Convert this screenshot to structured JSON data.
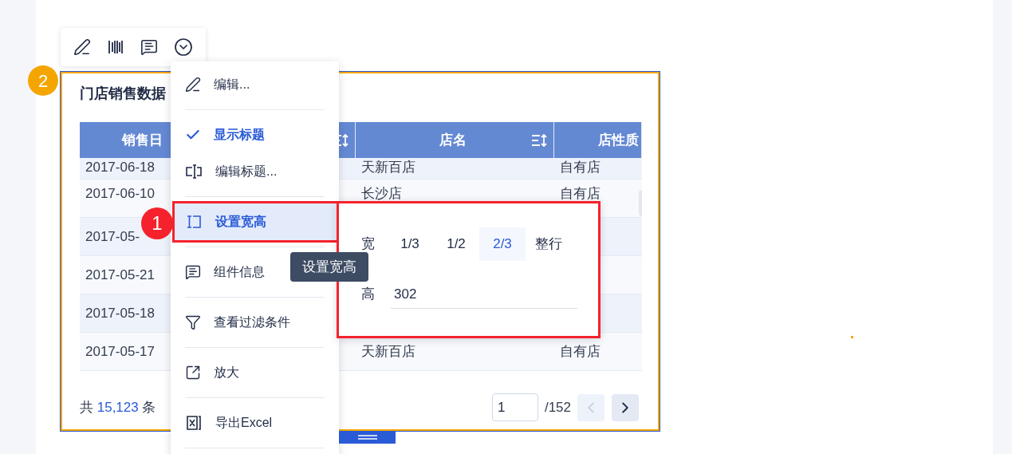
{
  "widget": {
    "title": "门店销售数据",
    "columns": [
      {
        "label": "销售日",
        "sortable": true
      },
      {
        "label": "店名",
        "sortable": true
      },
      {
        "label": "店性质",
        "sortable": false
      }
    ],
    "rows": [
      {
        "date": "2017-06-18",
        "store": "天新百店",
        "nature": "自有店"
      },
      {
        "date": "2017-06-10",
        "store": "长沙店",
        "nature": "自有店"
      },
      {
        "date": "2017-05-"
      },
      {
        "date": "2017-05-21"
      },
      {
        "date": "2017-05-18"
      },
      {
        "date": "2017-05-17",
        "store": "天新百店",
        "nature": "自有店"
      }
    ],
    "footer": {
      "prefix": "共",
      "count": "15,123",
      "suffix": "条"
    },
    "pager": {
      "page": "1",
      "total": "/152",
      "prev_disabled": true,
      "next_disabled": false
    }
  },
  "menu": {
    "groups": [
      {
        "items": [
          {
            "kind": "action",
            "label": "编辑...",
            "selected": false
          }
        ]
      },
      {
        "items": [
          {
            "kind": "toggle",
            "label": "显示标题",
            "checked": true,
            "selected": false
          },
          {
            "kind": "action",
            "label": "编辑标题...",
            "selected": false
          }
        ]
      },
      {
        "items": [
          {
            "kind": "action",
            "label": "设置宽高",
            "selected": true
          }
        ]
      },
      {
        "items": [
          {
            "kind": "action",
            "label": "组件信息",
            "selected": false
          }
        ]
      },
      {
        "items": [
          {
            "kind": "action",
            "label": "查看过滤条件",
            "selected": false
          }
        ]
      },
      {
        "items": [
          {
            "kind": "action",
            "label": "放大",
            "selected": false
          }
        ]
      },
      {
        "items": [
          {
            "kind": "action",
            "label": "导出Excel",
            "selected": false
          }
        ]
      }
    ]
  },
  "tooltip": "设置宽高",
  "size_popover": {
    "width_label": "宽",
    "width_options": [
      {
        "label": "1/3",
        "selected": false
      },
      {
        "label": "1/2",
        "selected": false
      },
      {
        "label": "2/3",
        "selected": true
      },
      {
        "label": "整行",
        "selected": false
      }
    ],
    "height_label": "高",
    "height_value": "302"
  },
  "badges": [
    {
      "label": "1",
      "color": "#f5222d"
    },
    {
      "label": "2",
      "color": "#f5a500"
    }
  ]
}
